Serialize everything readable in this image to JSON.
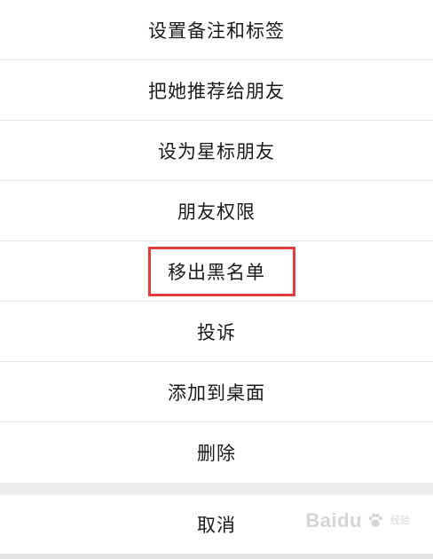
{
  "menu": {
    "items": [
      {
        "label": "设置备注和标签"
      },
      {
        "label": "把她推荐给朋友"
      },
      {
        "label": "设为星标朋友"
      },
      {
        "label": "朋友权限"
      },
      {
        "label": "移出黑名单"
      },
      {
        "label": "投诉"
      },
      {
        "label": "添加到桌面"
      },
      {
        "label": "删除"
      }
    ],
    "cancel_label": "取消"
  },
  "highlight": {
    "color": "#e23c3c",
    "item": "移出黑名单"
  },
  "watermark": {
    "logo_text": "Baidu",
    "sub_text": "经验",
    "icon": "paw-icon"
  }
}
